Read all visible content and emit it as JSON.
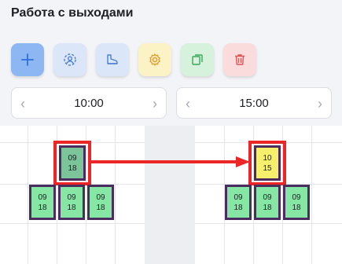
{
  "header": {
    "title": "Работа с выходами"
  },
  "toolbar": {
    "buttons": [
      {
        "name": "add",
        "icon": "plus-icon",
        "bg": "#8db7f2",
        "fg": "#2f6de0"
      },
      {
        "name": "users",
        "icon": "user-circle-icon",
        "bg": "#dbe6f9",
        "fg": "#4a7fd8"
      },
      {
        "name": "shoe",
        "icon": "shoe-icon",
        "bg": "#dbe6f9",
        "fg": "#4a7fd8"
      },
      {
        "name": "settings",
        "icon": "gear-icon",
        "bg": "#fbf2c6",
        "fg": "#e09a2a"
      },
      {
        "name": "copy",
        "icon": "copy-icon",
        "bg": "#d6f2dc",
        "fg": "#3aa859"
      },
      {
        "name": "delete",
        "icon": "trash-icon",
        "bg": "#fbdcdc",
        "fg": "#e05555"
      }
    ]
  },
  "time_left": {
    "value": "10:00",
    "prev": "‹",
    "next": "›"
  },
  "time_right": {
    "value": "15:00",
    "prev": "‹",
    "next": "›"
  },
  "left_grid": {
    "selected": {
      "top": "09",
      "bottom": "18"
    },
    "row": [
      {
        "top": "09",
        "bottom": "18"
      },
      {
        "top": "09",
        "bottom": "18"
      },
      {
        "top": "09",
        "bottom": "18"
      }
    ]
  },
  "right_grid": {
    "selected": {
      "top": "10",
      "bottom": "15"
    },
    "row": [
      {
        "top": "09",
        "bottom": "18"
      },
      {
        "top": "09",
        "bottom": "18"
      },
      {
        "top": "09",
        "bottom": "18"
      }
    ]
  },
  "colors": {
    "highlight": "#ec2626",
    "shift_green": "#86e6a4",
    "shift_selected_src": "#7cc49a",
    "shift_selected_dst": "#f5ef6c",
    "shift_border": "#4a2c5e"
  }
}
